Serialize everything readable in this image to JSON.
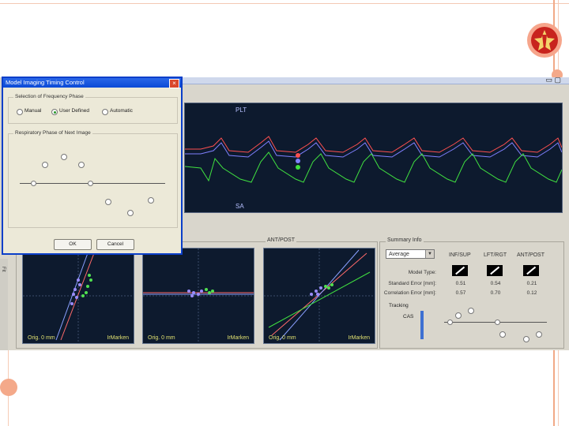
{
  "dialog": {
    "title": "Model Imaging Timing Control",
    "close_glyph": "×",
    "group_frequency": "Selection of Frequency Phase",
    "radio_manual": "Manual",
    "radio_user_defined": "User Defined",
    "radio_auto": "Automatic",
    "group_phase": "Respiratory Phase of Next Image",
    "ok_label": "OK",
    "cancel_label": "Cancel"
  },
  "main_plot": {
    "tag_top": "PLT",
    "tag_bottom": "SA",
    "colors": {
      "red": "#ff5050",
      "blue": "#7070ff",
      "green": "#40e040"
    }
  },
  "panels": [
    {
      "caption_left": "Orig. 0 mm",
      "caption_right": "IrMarken"
    },
    {
      "caption_left": "Orig. 0 mm",
      "caption_right": "IrMarken"
    },
    {
      "caption_left": "Orig. 0 mm",
      "caption_right": "IrMarken"
    }
  ],
  "group_captions": {
    "panel3": "ANT/POST",
    "summary": "Summary Info"
  },
  "summary": {
    "select_value": "Average",
    "col_headers": [
      "INF/SUP",
      "LFT/RGT",
      "ANT/POST"
    ],
    "row_labels": [
      "Model Type:",
      "Standard Error [mm]:",
      "Correlation Error [mm]:"
    ],
    "std_error": [
      "0.51",
      "0.54",
      "0.21"
    ],
    "corr_error": [
      "0.57",
      "0.70",
      "0.12"
    ],
    "status_label": "Tracking",
    "status_value": "CAS"
  },
  "left_edge_text": "Fit"
}
